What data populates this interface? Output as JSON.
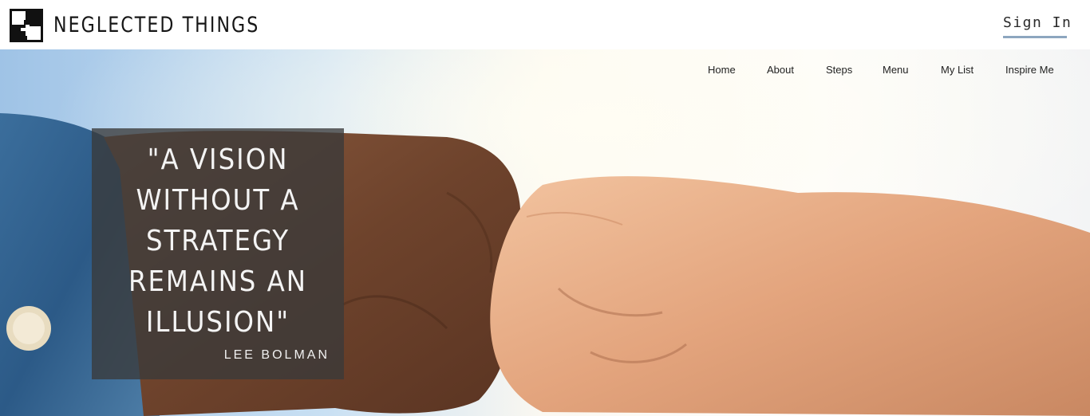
{
  "header": {
    "brand": "NEGLECTED THINGS",
    "sign_in_label": "Sign In"
  },
  "nav": {
    "items": [
      {
        "label": "Home"
      },
      {
        "label": "About"
      },
      {
        "label": "Steps"
      },
      {
        "label": "Menu"
      },
      {
        "label": "My List"
      },
      {
        "label": "Inspire Me"
      }
    ]
  },
  "hero": {
    "image": "fist-bump-photo",
    "quote": "\"A VISION WITHOUT A STRATEGY REMAINS AN ILLUSION\"",
    "author": "LEE BOLMAN"
  },
  "colors": {
    "accent_underline": "#8da6bf",
    "quote_overlay": "#3a3a3a"
  }
}
